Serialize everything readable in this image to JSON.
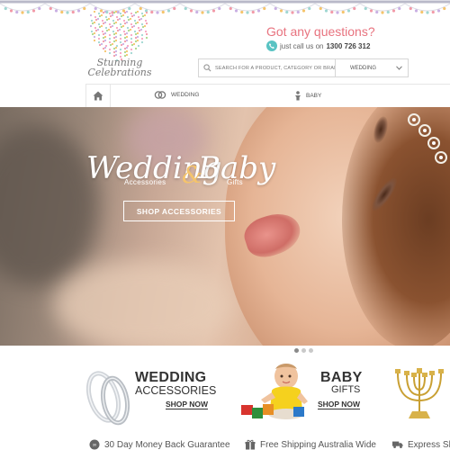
{
  "colors": {
    "accent": "#e8737f",
    "phone": "#59c3c3",
    "bunting": [
      "#f5c46b",
      "#9fd7d2",
      "#f29aa8",
      "#c9b0e3"
    ]
  },
  "header": {
    "logo": {
      "line1": "Stunning",
      "line2": "Celebrations"
    },
    "contact": {
      "title": "Got any questions?",
      "prefix": "just call us on",
      "number": "1300 726 312",
      "icon": "phone-icon"
    },
    "search": {
      "placeholder": "SEARCH FOR A PRODUCT, CATEGORY OR BRAND",
      "category": "WEDDING",
      "icon": "search-icon"
    }
  },
  "nav": {
    "home_icon": "home-icon",
    "items": [
      {
        "label": "WEDDING",
        "icon": "rings-icon"
      },
      {
        "label": "BABY",
        "icon": "baby-icon"
      }
    ]
  },
  "hero": {
    "title_left": "Wedding",
    "amp": "&",
    "title_right": "Baby",
    "sub_left": "Accessories",
    "sub_right": "Gifts",
    "button": "SHOP ACCESSORIES",
    "slides": 3,
    "active_slide": 1
  },
  "promos": [
    {
      "title": "WEDDING",
      "subtitle": "ACCESSORIES",
      "link": "SHOP NOW",
      "icon": "wedding-rings-image"
    },
    {
      "title": "BABY",
      "subtitle": "GIFTS",
      "link": "SHOP NOW",
      "icon": "baby-with-blocks-image"
    },
    {
      "icon": "menorah-image"
    }
  ],
  "benefits": [
    {
      "label": "30 Day Money Back Guarantee",
      "icon": "badge-icon"
    },
    {
      "label": "Free Shipping Australia Wide",
      "icon": "gift-icon"
    },
    {
      "label": "Express Sh",
      "icon": "truck-icon"
    }
  ]
}
